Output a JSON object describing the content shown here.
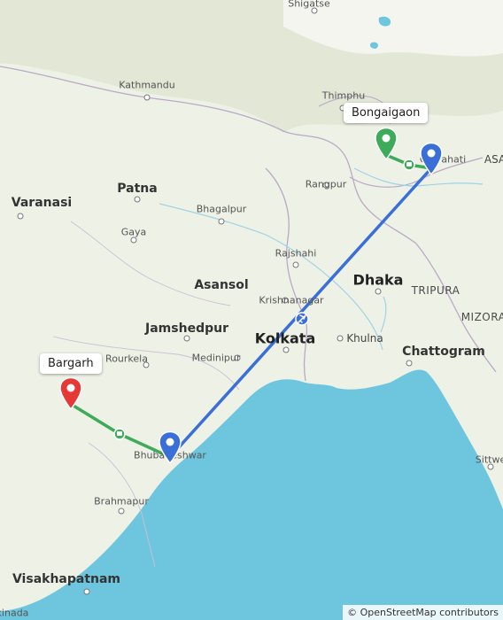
{
  "map": {
    "attribution": "© OpenStreetMap contributors",
    "colors": {
      "water": "#6ec6de",
      "land": "#eef1e6",
      "train_route": "#3dab5a",
      "flight_route": "#3b6fd8",
      "origin_pin": "#e53935",
      "stop_pin": "#3b6fd8",
      "destination_pin": "#3dab5a"
    },
    "callouts": {
      "origin": "Bargarh",
      "destination": "Bongaigaon"
    },
    "places": {
      "shigatse": "Shigatse",
      "kathmandu": "Kathmandu",
      "thimphu": "Thimphu",
      "guwahati": "Guwahati",
      "asam": "ASA",
      "rangpur": "Rangpur",
      "varanasi": "Varanasi",
      "patna": "Patna",
      "bhagalpur": "Bhagalpur",
      "gaya": "Gaya",
      "rajshahi": "Rajshahi",
      "asansol": "Asansol",
      "dhaka": "Dhaka",
      "tripura": "TRIPURA",
      "krishnanagar": "Krishnanagar",
      "mizoram": "MIZORA",
      "jamshedpur": "Jamshedpur",
      "kolkata": "Kolkata",
      "khulna": "Khulna",
      "chattogram": "Chattogram",
      "rourkela": "Rourkela",
      "medinipur": "Medinipur",
      "bhubaneswar": "Bhubaneshwar",
      "sittwe": "Sittwe",
      "brahmapur": "Brahmapur",
      "visakhapatnam": "Visakhapatnam",
      "kakinada": "kinada"
    },
    "icons": {
      "origin": "map-pin-red-icon",
      "stop": "map-pin-blue-icon",
      "destination": "map-pin-green-icon",
      "train": "train-icon",
      "flight": "airplane-icon"
    }
  }
}
